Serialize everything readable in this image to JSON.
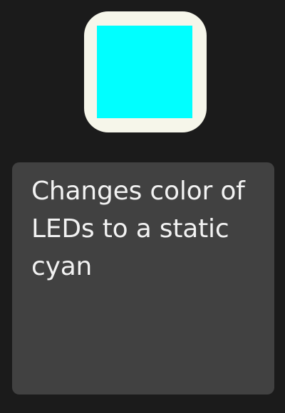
{
  "swatch": {
    "color": "#00ffff",
    "tile_color": "#f6f6ea"
  },
  "description": {
    "text": "Changes color of LEDs to a static cyan"
  }
}
